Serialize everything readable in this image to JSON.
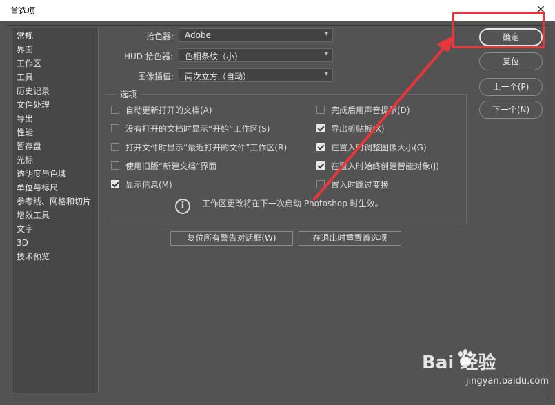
{
  "window": {
    "title": "首选项",
    "close_glyph": "✕"
  },
  "sidebar": {
    "items": [
      {
        "label": "常规",
        "selected": true
      },
      {
        "label": "界面"
      },
      {
        "label": "工作区"
      },
      {
        "label": "工具"
      },
      {
        "label": "历史记录"
      },
      {
        "label": "文件处理"
      },
      {
        "label": "导出"
      },
      {
        "label": "性能"
      },
      {
        "label": "暂存盘"
      },
      {
        "label": "光标"
      },
      {
        "label": "透明度与色域"
      },
      {
        "label": "单位与标尺"
      },
      {
        "label": "参考线、网格和切片"
      },
      {
        "label": "增效工具"
      },
      {
        "label": "文字"
      },
      {
        "label": "3D"
      },
      {
        "label": "技术预览"
      }
    ]
  },
  "fields": {
    "color_picker": {
      "label": "拾色器:",
      "value": "Adobe"
    },
    "hud_color_picker": {
      "label": "HUD 拾色器:",
      "value": "色相条纹（小）"
    },
    "image_interpolation": {
      "label": "图像插值:",
      "value": "两次立方（自动）"
    }
  },
  "options": {
    "title": "选项",
    "left": [
      {
        "label": "自动更新打开的文档(A)",
        "checked": false
      },
      {
        "label": "没有打开的文档时显示“开始”工作区(S)",
        "checked": false
      },
      {
        "label": "打开文件时显示“最近打开的文件”工作区(R)",
        "checked": false
      },
      {
        "label": "使用旧版“新建文档”界面",
        "checked": false
      },
      {
        "label": "显示信息(M)",
        "checked": true
      }
    ],
    "right": [
      {
        "label": "完成后用声音提示(D)",
        "checked": false
      },
      {
        "label": "导出剪贴板(X)",
        "checked": true
      },
      {
        "label": "在置入时调整图像大小(G)",
        "checked": true
      },
      {
        "label": "在置入时始终创建智能对象(J)",
        "checked": true
      },
      {
        "label": "置入时跳过变换",
        "checked": false
      }
    ],
    "info": "工作区更改将在下一次启动 Photoshop 时生效。"
  },
  "buttons": {
    "ok": "确定",
    "reset": "复位",
    "prev": "上一个(P)",
    "next": "下一个(N)",
    "reset_warnings": "复位所有警告对话框(W)",
    "reset_on_quit": "在退出时重置首选项"
  },
  "annotation": {
    "color": "#e8363a"
  },
  "watermark": {
    "brand": "Bai  经验",
    "url": "jingyan.baidu.com"
  }
}
